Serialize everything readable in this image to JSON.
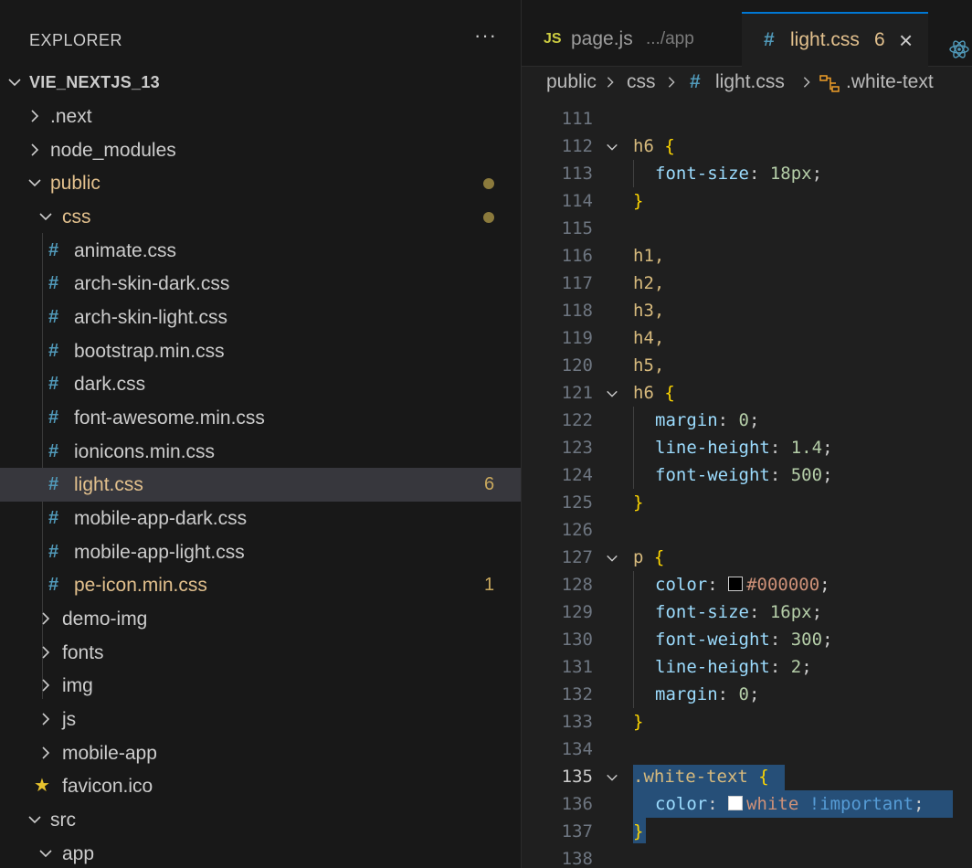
{
  "explorer": {
    "title": "EXPLORER",
    "more": "···",
    "root": "VIE_NEXTJS_13",
    "items": [
      {
        "label": ".next"
      },
      {
        "label": "node_modules"
      },
      {
        "label": "public"
      },
      {
        "label": "css"
      },
      {
        "label": "animate.css"
      },
      {
        "label": "arch-skin-dark.css"
      },
      {
        "label": "arch-skin-light.css"
      },
      {
        "label": "bootstrap.min.css"
      },
      {
        "label": "dark.css"
      },
      {
        "label": "font-awesome.min.css"
      },
      {
        "label": "ionicons.min.css"
      },
      {
        "label": "light.css",
        "problems": "6"
      },
      {
        "label": "mobile-app-dark.css"
      },
      {
        "label": "mobile-app-light.css"
      },
      {
        "label": "pe-icon.min.css",
        "problems": "1"
      },
      {
        "label": "demo-img"
      },
      {
        "label": "fonts"
      },
      {
        "label": "img"
      },
      {
        "label": "js"
      },
      {
        "label": "mobile-app"
      },
      {
        "label": "favicon.ico"
      },
      {
        "label": "src"
      },
      {
        "label": "app"
      }
    ],
    "hash": "#",
    "star": "★"
  },
  "tabs": {
    "page": {
      "badge": "JS",
      "label": "page.js",
      "path": ".../app"
    },
    "light": {
      "hash": "#",
      "label": "light.css",
      "problems": "6",
      "close": "×"
    }
  },
  "breadcrumb": {
    "parts": [
      "public",
      "css",
      "#",
      "light.css",
      ".white-text"
    ]
  },
  "code": {
    "numbers": [
      "111",
      "112",
      "113",
      "114",
      "115",
      "116",
      "117",
      "118",
      "119",
      "120",
      "121",
      "122",
      "123",
      "124",
      "125",
      "126",
      "127",
      "128",
      "129",
      "130",
      "131",
      "132",
      "133",
      "134",
      "135",
      "136",
      "137",
      "138"
    ],
    "t112a": "h6",
    "t112b": " {",
    "t113a": "font-size",
    "t113b": ": ",
    "t113c": "18px",
    "t113d": ";",
    "t114": "}",
    "t116": "h1,",
    "t117": "h2,",
    "t118": "h3,",
    "t119": "h4,",
    "t120": "h5,",
    "t121a": "h6",
    "t121b": " {",
    "t122a": "margin",
    "t122b": ": ",
    "t122c": "0",
    "t122d": ";",
    "t123a": "line-height",
    "t123b": ": ",
    "t123c": "1.4",
    "t123d": ";",
    "t124a": "font-weight",
    "t124b": ": ",
    "t124c": "500",
    "t124d": ";",
    "t125": "}",
    "t127a": "p",
    "t127b": " {",
    "t128a": "color",
    "t128b": ": ",
    "t128c": "#000000",
    "t128d": ";",
    "t129a": "font-size",
    "t129b": ": ",
    "t129c": "16px",
    "t129d": ";",
    "t130a": "font-weight",
    "t130b": ": ",
    "t130c": "300",
    "t130d": ";",
    "t131a": "line-height",
    "t131b": ": ",
    "t131c": "2",
    "t131d": ";",
    "t132a": "margin",
    "t132b": ": ",
    "t132c": "0",
    "t132d": ";",
    "t133": "}",
    "t135a": ".white-text",
    "t135b": " {",
    "t136a": "color",
    "t136b": ": ",
    "t136c": "white",
    "t136d": " !important",
    "t136e": ";",
    "t137": "}"
  },
  "colors": {
    "accent": "#0078d4",
    "modified": "#e2c08d",
    "selection": "#264f78",
    "swatch_black": "#000000",
    "swatch_white": "#ffffff"
  }
}
